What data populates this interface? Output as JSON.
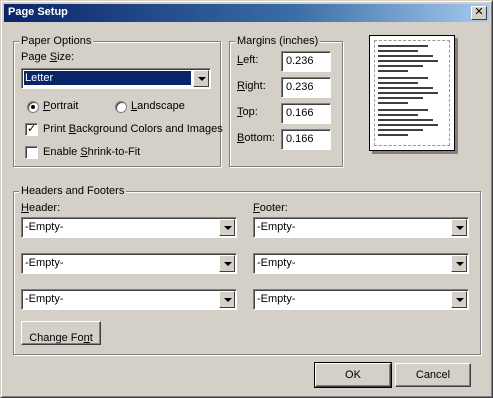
{
  "window": {
    "title": "Page Setup",
    "close_label": "✕"
  },
  "paper_options": {
    "group_label": "Paper Options",
    "page_size_label_pre": "Page ",
    "page_size_label_u": "S",
    "page_size_label_post": "ize:",
    "page_size_value": "Letter",
    "portrait_u": "P",
    "portrait_post": "ortrait",
    "portrait_checked": true,
    "landscape_u": "L",
    "landscape_post": "andscape",
    "landscape_checked": false,
    "print_bg_pre": "Print ",
    "print_bg_u": "B",
    "print_bg_post": "ackground Colors and Images",
    "print_bg_checked": true,
    "shrink_pre": "Enable ",
    "shrink_u": "S",
    "shrink_post": "hrink-to-Fit",
    "shrink_checked": false
  },
  "margins": {
    "group_label": "Margins (inches)",
    "left_u": "L",
    "left_post": "eft:",
    "left_value": "0.236",
    "right_u": "R",
    "right_post": "ight:",
    "right_value": "0.236",
    "top_u": "T",
    "top_post": "op:",
    "top_value": "0.166",
    "bottom_u": "B",
    "bottom_post": "ottom:",
    "bottom_value": "0.166"
  },
  "headers_footers": {
    "group_label": "Headers and Footers",
    "header_u": "H",
    "header_post": "eader:",
    "footer_u": "F",
    "footer_post": "ooter:",
    "header_values": [
      "-Empty-",
      "-Empty-",
      "-Empty-"
    ],
    "footer_values": [
      "-Empty-",
      "-Empty-",
      "-Empty-"
    ],
    "change_font_pre": "Change Fo",
    "change_font_u": "n",
    "change_font_post": "t"
  },
  "buttons": {
    "ok": "OK",
    "cancel": "Cancel"
  }
}
